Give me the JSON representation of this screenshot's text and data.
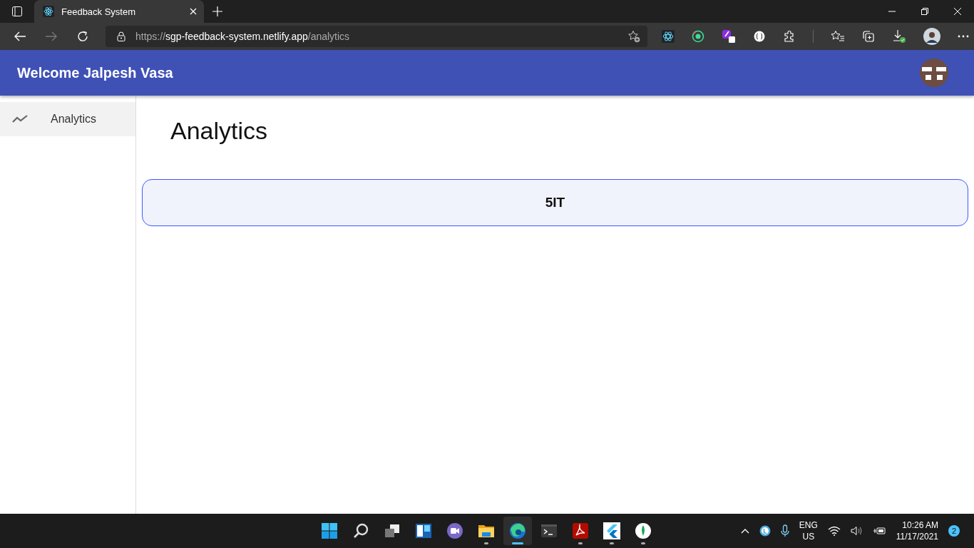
{
  "browser": {
    "tab": {
      "title": "Feedback System",
      "selected": true
    },
    "url": {
      "scheme": "https://",
      "host": "sgp-feedback-system.netlify.app",
      "path": "/analytics"
    },
    "extensions": [
      {
        "kind": "react"
      },
      {
        "kind": "target"
      },
      {
        "kind": "pen"
      },
      {
        "kind": "braces"
      },
      {
        "kind": "puzzle"
      }
    ],
    "tools": [
      {
        "kind": "favorites"
      },
      {
        "kind": "collections"
      },
      {
        "kind": "downloads"
      }
    ]
  },
  "app_bar": {
    "title": "Welcome Jalpesh Vasa"
  },
  "sidebar": {
    "items": [
      {
        "label": "Analytics",
        "selected": true
      }
    ]
  },
  "page": {
    "heading": "Analytics",
    "cards": [
      {
        "label": "5IT"
      }
    ]
  },
  "taskbar": {
    "apps": [
      {
        "kind": "start",
        "running": false,
        "selected": false
      },
      {
        "kind": "search",
        "running": false,
        "selected": false
      },
      {
        "kind": "taskview",
        "running": false,
        "selected": false
      },
      {
        "kind": "widgets",
        "running": false,
        "selected": false
      },
      {
        "kind": "chat",
        "running": false,
        "selected": false
      },
      {
        "kind": "explorer",
        "running": true,
        "selected": false
      },
      {
        "kind": "edge",
        "running": true,
        "selected": true
      },
      {
        "kind": "terminal",
        "running": false,
        "selected": false
      },
      {
        "kind": "pdf",
        "running": true,
        "selected": false
      },
      {
        "kind": "flutter",
        "running": true,
        "selected": false
      },
      {
        "kind": "mongo",
        "running": true,
        "selected": false
      }
    ],
    "language": [
      "ENG",
      "US"
    ],
    "time": "10:26 AM",
    "date": "11/17/2021",
    "notifications": "2"
  }
}
